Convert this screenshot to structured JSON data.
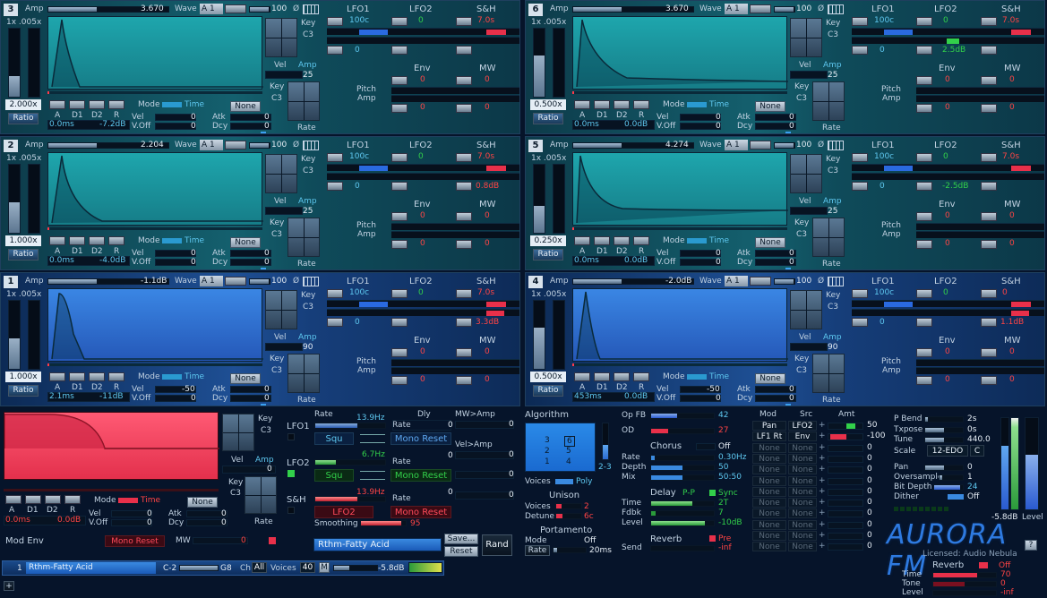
{
  "operators": [
    {
      "num": "3",
      "amp": "3.670",
      "wave": "A 1",
      "ratio": "2.000x",
      "sub": "1x .005x",
      "d1time": "0.0ms",
      "sustain": "-7.2dB",
      "vamp": "25",
      "lfo1": "100c",
      "sh": "7.0s",
      "lfo2row": "",
      "shrow": ""
    },
    {
      "num": "6",
      "amp": "3.670",
      "wave": "A 1",
      "ratio": "0.500x",
      "sub": "1x .005x",
      "d1time": "0.0ms",
      "sustain": "0.0dB",
      "vamp": "25",
      "lfo1": "100c",
      "sh": "7.0s",
      "lfo2row": "2.5dB",
      "shrow": ""
    },
    {
      "num": "2",
      "amp": "2.204",
      "wave": "A 1",
      "ratio": "1.000x",
      "sub": "1x .005x",
      "d1time": "0.0ms",
      "sustain": "-4.0dB",
      "vamp": "25",
      "lfo1": "100c",
      "sh": "7.0s",
      "lfo2row": "",
      "shrow": "0.8dB"
    },
    {
      "num": "5",
      "amp": "4.274",
      "wave": "A 1",
      "ratio": "0.250x",
      "sub": "1x .005x",
      "d1time": "0.0ms",
      "sustain": "0.0dB",
      "vamp": "25",
      "lfo1": "100c",
      "sh": "7.0s",
      "lfo2row": "-2.5dB",
      "shrow": ""
    },
    {
      "num": "1",
      "amp": "-1.1dB",
      "wave": "A 1",
      "ratio": "1.000x",
      "sub": "1x .005x",
      "d1time": "2.1ms",
      "sustain": "-11dB",
      "vamp": "90",
      "lfo1": "100c",
      "sh": "7.0s",
      "lfo2row": "",
      "shrow": "3.3dB",
      "vel": "-50"
    },
    {
      "num": "4",
      "amp": "-2.0dB",
      "wave": "A 1",
      "ratio": "0.500x",
      "sub": "1x .005x",
      "d1time": "453ms",
      "sustain": "0.0dB",
      "vamp": "90",
      "lfo1": "100c",
      "sh": "0",
      "lfo2row": "",
      "shrow": "1.1dB",
      "vel": "-50"
    }
  ],
  "labels": {
    "amp": "Amp",
    "wave": "Wave",
    "hundred": "100",
    "phase": "Ø",
    "key": "Key",
    "c3": "C3",
    "vel": "Vel",
    "rate": "Rate",
    "ratio": "Ratio",
    "mode": "Mode",
    "time": "Time",
    "none": "None",
    "a": "A",
    "d1": "D1",
    "d2": "D2",
    "r": "R",
    "vel2": "Vel",
    "voff": "V.Off",
    "atk": "Atk",
    "dcy": "Dcy",
    "lfo1": "LFO1",
    "lfo2": "LFO2",
    "sh": "S&H",
    "env": "Env",
    "mw": "MW",
    "pitch": "Pitch",
    "ampl": "Amp",
    "zero": "0"
  },
  "modenv": {
    "title": "Mod Env",
    "d1time": "0.0ms",
    "sustain": "0.0dB",
    "mono_reset": "Mono Reset",
    "mw": "MW",
    "mw_val": "0",
    "vamp": "0"
  },
  "lfos": {
    "lfo1": {
      "name": "LFO1",
      "rate": "13.9Hz",
      "wave": "Squ",
      "dly": "Dly",
      "dly_val": "0",
      "rate_lbl": "Rate",
      "rate_val": "0",
      "mono": "Mono Reset",
      "mwamp": "MW>Amp",
      "mwamp_val": "0",
      "velamp": "Vel>Amp",
      "velamp_val": "0"
    },
    "lfo2": {
      "name": "LFO2",
      "rate": "6.7Hz",
      "wave": "Squ",
      "rate_val": "0",
      "mono": "Mono Reset",
      "v": "0"
    },
    "sh": {
      "name": "S&H",
      "rate": "13.9Hz",
      "src": "LFO2",
      "rate_val": "0",
      "mono": "Mono Reset",
      "smoothing": "Smoothing",
      "smooth_val": "95",
      "v": "0"
    },
    "rate_label": "Rate"
  },
  "patch": {
    "name": "Rthm-Fatty Acid",
    "save": "Save...",
    "reset": "Reset",
    "rand": "Rand"
  },
  "algo": {
    "title": "Algorithm",
    "rows": [
      [
        "3",
        "6"
      ],
      [
        "2",
        "5"
      ],
      [
        "1",
        "4"
      ]
    ],
    "sel": "2-3",
    "voices": "Voices",
    "poly": "Poly"
  },
  "unison": {
    "title": "Unison",
    "voices": "Voices",
    "voices_val": "2",
    "detune": "Detune",
    "detune_val": "6c"
  },
  "porta": {
    "title": "Portamento",
    "mode": "Mode",
    "mode_val": "Off",
    "rate": "Rate",
    "rate_val": "20ms"
  },
  "fx": {
    "opfb": "Op FB",
    "opfb_val": "42",
    "od": "OD",
    "od_val": "27",
    "chorus": "Chorus",
    "chorus_val": "Off",
    "rate": "Rate",
    "rate_val": "0.30Hz",
    "depth": "Depth",
    "depth_val": "50",
    "mix": "Mix",
    "mix_val": "50:50",
    "delay": "Delay",
    "pp": "P-P",
    "sync": "Sync",
    "time": "Time",
    "time_val": "2T",
    "fdbk": "Fdbk",
    "fdbk_val": "7",
    "level": "Level",
    "level_val": "-10dB",
    "send": "Send",
    "reverb": "Reverb",
    "reverb_val": "-inf",
    "pre": "Pre"
  },
  "modmatrix": {
    "mod": "Mod",
    "src": "Src",
    "amt": "Amt",
    "rows": [
      [
        "Pan",
        "LFO2",
        "+",
        "50"
      ],
      [
        "LF1 Rt",
        "Env",
        "+",
        "-100"
      ],
      [
        "None",
        "None",
        "+",
        "0"
      ],
      [
        "None",
        "None",
        "+",
        "0"
      ],
      [
        "None",
        "None",
        "+",
        "0"
      ],
      [
        "None",
        "None",
        "+",
        "0"
      ],
      [
        "None",
        "None",
        "+",
        "0"
      ],
      [
        "None",
        "None",
        "+",
        "0"
      ],
      [
        "None",
        "None",
        "+",
        "0"
      ],
      [
        "None",
        "None",
        "+",
        "0"
      ],
      [
        "None",
        "None",
        "+",
        "0"
      ],
      [
        "None",
        "None",
        "+",
        "0"
      ]
    ]
  },
  "global": {
    "pbend": "P Bend",
    "pbend_val": "2s",
    "txpose": "Txpose",
    "txpose_val": "0s",
    "tune": "Tune",
    "tune_val": "440.0",
    "scale": "Scale",
    "scale_val": "12-EDO",
    "scale_btn": "C",
    "pan": "Pan",
    "pan_val": "0",
    "oversample": "Oversample",
    "oversample_val": "1",
    "bitdepth": "Bit Depth",
    "bitdepth_val": "24",
    "dither": "Dither",
    "dither_val": "Off",
    "level": "Level",
    "level_val": "-5.8dB"
  },
  "brand": {
    "logo": "AURORA FM",
    "licensed": "Licensed: Audio Nebula",
    "help": "?"
  },
  "reverb2": {
    "title": "Reverb",
    "off": "Off",
    "time": "Time",
    "time_val": "70",
    "tone": "Tone",
    "tone_val": "0",
    "level": "Level",
    "level_val": "-inf"
  },
  "bottom": {
    "slot": "1",
    "patch": "Rthm-Fatty Acid",
    "range_lo": "C-2",
    "range_hi": "G8",
    "ch": "Ch",
    "all": "All",
    "voices": "Voices",
    "voices_val": "40",
    "m": "M",
    "level": "-5.8dB",
    "plus": "+"
  },
  "colors": {
    "teal": "#14606e",
    "blue": "#1e4f94",
    "red": "#e8304a",
    "green": "#32d04a"
  }
}
